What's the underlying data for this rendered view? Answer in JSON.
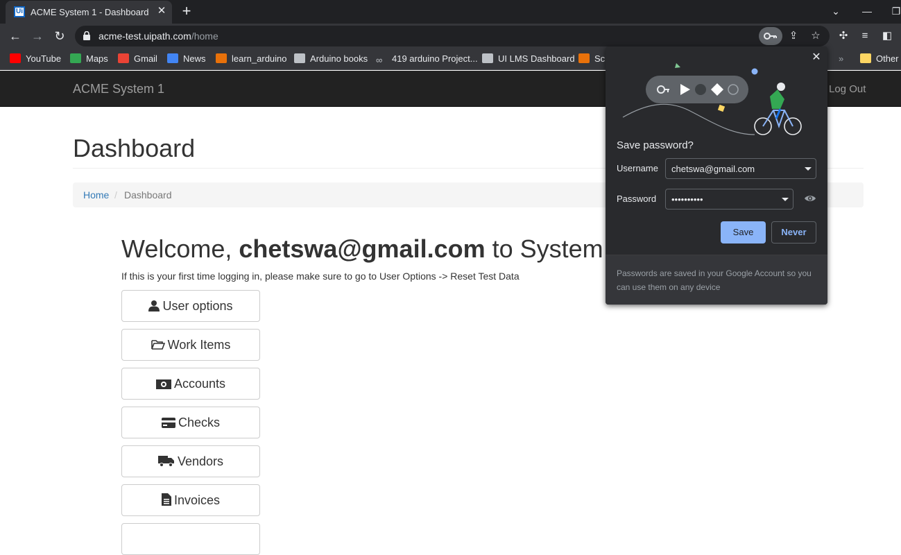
{
  "browser": {
    "tab": {
      "title": "ACME System 1 - Dashboard",
      "favicon_text": "Ui"
    },
    "url": {
      "host": "acme-test.uipath.com",
      "path": "/home"
    },
    "bookmarks": [
      {
        "label": "YouTube",
        "icon": "youtube-icon",
        "color": "#ff0000"
      },
      {
        "label": "Maps",
        "icon": "maps-icon",
        "color": "#34a853"
      },
      {
        "label": "Gmail",
        "icon": "gmail-icon",
        "color": "#ea4335"
      },
      {
        "label": "News",
        "icon": "news-icon",
        "color": "#4285f4"
      },
      {
        "label": "learn_arduino",
        "icon": "arduino-icon",
        "color": "#e8710a"
      },
      {
        "label": "Arduino books",
        "icon": "grid-icon",
        "color": "#bdc1c6"
      },
      {
        "label": "419 arduino Project...",
        "icon": "infinity-icon",
        "color": "#bdc1c6"
      },
      {
        "label": "UI LMS Dashboard",
        "icon": "lms-icon",
        "color": "#bdc1c6"
      },
      {
        "label": "Sci",
        "icon": "sci-icon",
        "color": "#e8710a"
      }
    ],
    "bookmarks_overflow": "»",
    "other_bookmarks": "Other"
  },
  "app": {
    "brand": "ACME System 1",
    "logout": "Log Out",
    "page_title": "Dashboard",
    "breadcrumb": {
      "home": "Home",
      "separator": "/",
      "current": "Dashboard"
    },
    "welcome": {
      "prefix": "Welcome, ",
      "user": "chetswa@gmail.com",
      "suffix": " to System"
    },
    "intro": "If this is your first time logging in, please make sure to go to User Options -> Reset Test Data",
    "menu": [
      {
        "label": "User options",
        "icon": "user-icon"
      },
      {
        "label": "Work Items",
        "icon": "folder-open-icon"
      },
      {
        "label": "Accounts",
        "icon": "money-icon"
      },
      {
        "label": "Checks",
        "icon": "credit-card-icon"
      },
      {
        "label": "Vendors",
        "icon": "truck-icon"
      },
      {
        "label": "Invoices",
        "icon": "file-text-icon"
      }
    ]
  },
  "save_password_popup": {
    "title": "Save password?",
    "username_label": "Username",
    "username_value": "chetswa@gmail.com",
    "password_label": "Password",
    "password_value": "••••••••••",
    "save_label": "Save",
    "never_label": "Never",
    "footer": "Passwords are saved in your Google Account so you can use them on any device"
  }
}
